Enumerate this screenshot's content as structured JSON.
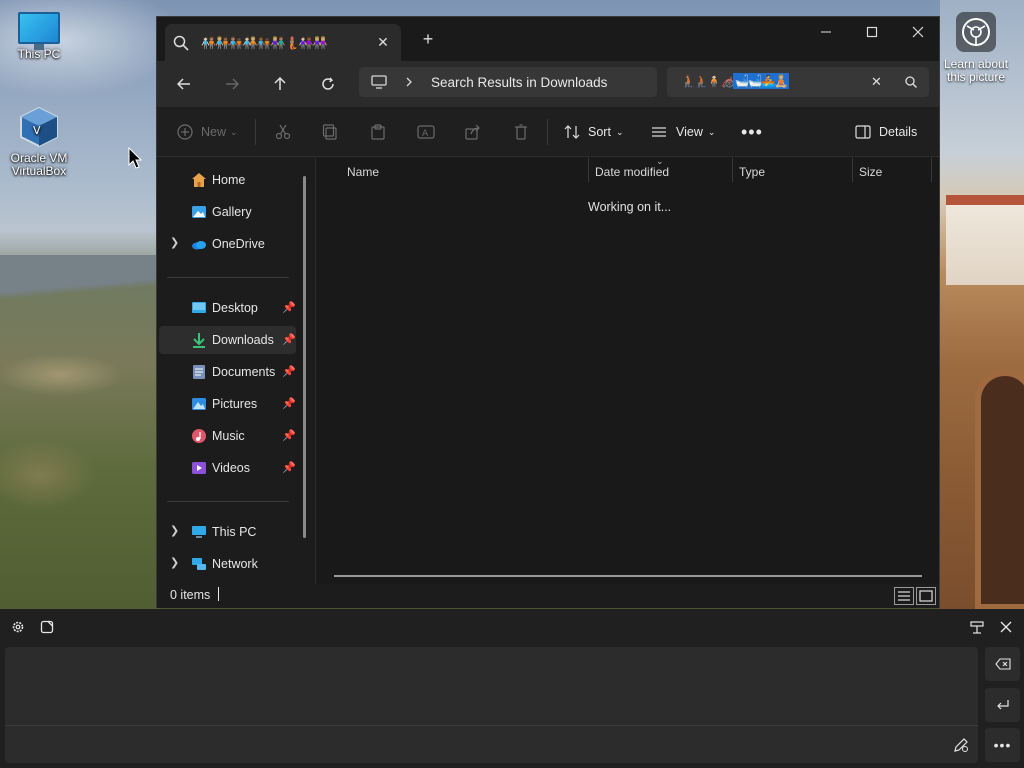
{
  "desktop": {
    "icons": [
      {
        "label": "This PC"
      },
      {
        "label": "Oracle VM VirtualBox"
      }
    ],
    "learn_label": "Learn about this picture"
  },
  "window": {
    "tab_title": "🧑🏻‍🤝‍🧑🏽🧑🏼‍🤝‍🧑🏾🧑🏽‍🤝‍🧑🏿🧑🏻‍🤝‍🧑🏼🧑🏾‍🤝‍🧑🏿👩🏼‍🤝‍👨🏽🧜🏽👩🏻‍🤝‍👩🏾👭🏼",
    "address": {
      "path_label": "Search Results in Downloads",
      "search_query_plain": "🧎🏽🧎🏾🧍🏻🦽",
      "search_query_selected": "🛁🛁🚣🧘🏼"
    },
    "commands": {
      "new": "New",
      "sort": "Sort",
      "view": "View",
      "details": "Details"
    },
    "nav": {
      "items": [
        {
          "label": "Home"
        },
        {
          "label": "Gallery"
        },
        {
          "label": "OneDrive"
        },
        {
          "label": "Desktop"
        },
        {
          "label": "Downloads"
        },
        {
          "label": "Documents"
        },
        {
          "label": "Pictures"
        },
        {
          "label": "Music"
        },
        {
          "label": "Videos"
        },
        {
          "label": "This PC"
        },
        {
          "label": "Network"
        }
      ]
    },
    "columns": [
      "Name",
      "Date modified",
      "Type",
      "Size"
    ],
    "working_text": "Working on it...",
    "status": "0 items"
  },
  "colors": {
    "accent": "#1f6fd0",
    "window_bg": "#1c1c1c",
    "panel_bg": "#202020"
  }
}
